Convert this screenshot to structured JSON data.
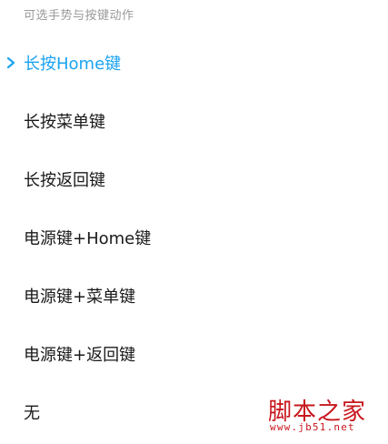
{
  "section_header": "可选手势与按键动作",
  "options": [
    {
      "label": "长按Home键",
      "selected": true
    },
    {
      "label": "长按菜单键",
      "selected": false
    },
    {
      "label": "长按返回键",
      "selected": false
    },
    {
      "label": "电源键+Home键",
      "selected": false
    },
    {
      "label": "电源键+菜单键",
      "selected": false
    },
    {
      "label": "电源键+返回键",
      "selected": false
    },
    {
      "label": "无",
      "selected": false
    }
  ],
  "selected_icon": "chevron-right-icon",
  "colors": {
    "accent": "#1aa3f0",
    "text": "#1a1a1a",
    "header": "#9a9a9a",
    "watermark": "#c8161d"
  },
  "watermark": {
    "title": "脚本之家",
    "url": "www.jb51.net"
  }
}
